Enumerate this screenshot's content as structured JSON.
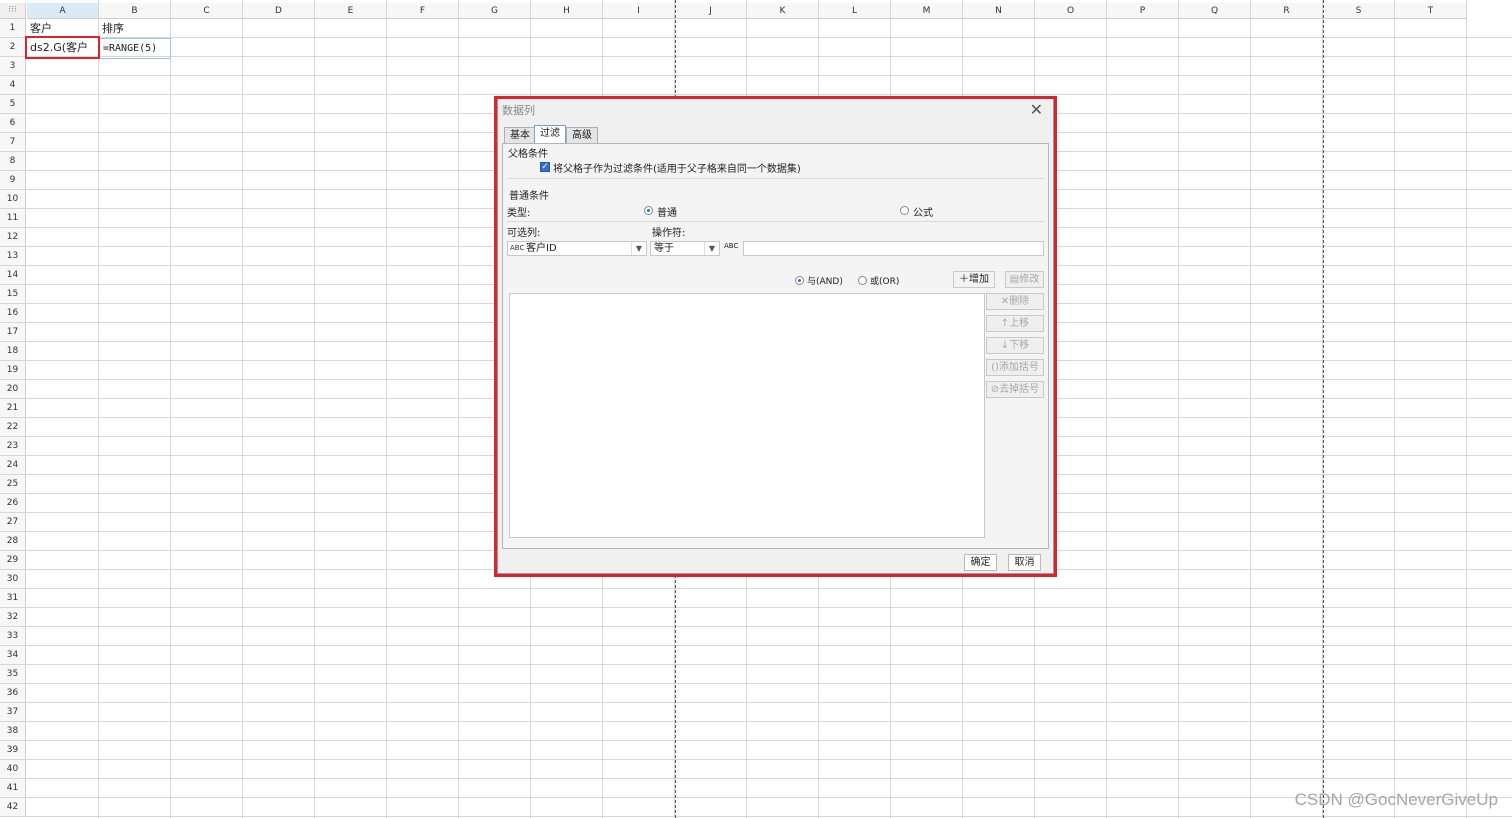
{
  "sheet": {
    "corner": "⁝⁝⁝",
    "columns": [
      "A",
      "B",
      "C",
      "D",
      "E",
      "F",
      "G",
      "H",
      "I",
      "J",
      "K",
      "L",
      "M",
      "N",
      "O",
      "P",
      "Q",
      "R",
      "S",
      "T"
    ],
    "rows": [
      "1",
      "2",
      "3",
      "4",
      "5",
      "6",
      "7",
      "8",
      "9",
      "10",
      "11",
      "12",
      "13",
      "14",
      "15",
      "16",
      "17",
      "18",
      "19",
      "20",
      "21",
      "22",
      "23",
      "24",
      "25",
      "26",
      "27",
      "28",
      "29",
      "30",
      "31",
      "32",
      "33",
      "34",
      "35",
      "36",
      "37",
      "38",
      "39",
      "40",
      "41",
      "42"
    ],
    "cells": {
      "A1": "客户",
      "B1": "排序",
      "A2": "ds2.G(客户",
      "B2": "=RANGE(5)"
    }
  },
  "dialog": {
    "title": "数据列",
    "close_glyph": "✕",
    "tabs": [
      "基本",
      "过滤",
      "高级"
    ],
    "active_tab": "过滤",
    "parent_section": "父格条件",
    "parent_checkbox_label": "将父格子作为过滤条件(适用于父子格来自同一个数据集)",
    "parent_checkbox_checked": true,
    "normal_section": "普通条件",
    "type_label": "类型:",
    "type_option_normal": "普通",
    "type_option_formula": "公式",
    "column_label": "可选列:",
    "operator_label": "操作符:",
    "column_value": "客户ID",
    "operator_value": "等于",
    "value_input": "",
    "and_label": "与(AND)",
    "or_label": "或(OR)",
    "add_button": "增加",
    "modify_button": "修改",
    "delete_button": "删除",
    "move_up_button": "上移",
    "move_down_button": "下移",
    "add_bracket_button": "添加括号",
    "remove_bracket_button": "去掉括号",
    "ok_button": "确定",
    "cancel_button": "取消",
    "abc_glyph": "ABC"
  },
  "watermark": "CSDN @GocNeverGiveUp",
  "colors": {
    "highlight": "#d9232d",
    "accent": "#2f6fd1"
  }
}
